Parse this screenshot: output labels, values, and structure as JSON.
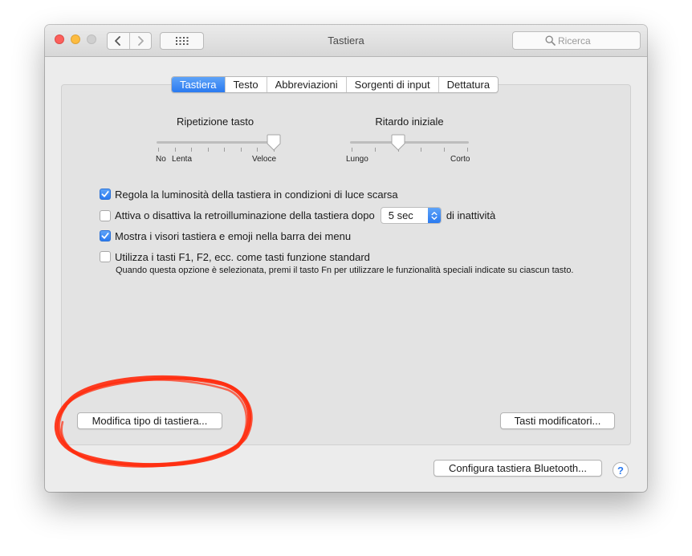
{
  "window": {
    "title": "Tastiera"
  },
  "toolbar": {
    "search_placeholder": "Ricerca"
  },
  "tabs": [
    {
      "label": "Tastiera",
      "active": true
    },
    {
      "label": "Testo",
      "active": false
    },
    {
      "label": "Abbreviazioni",
      "active": false
    },
    {
      "label": "Sorgenti di input",
      "active": false
    },
    {
      "label": "Dettatura",
      "active": false
    }
  ],
  "sliders": {
    "key_repeat": {
      "title": "Ripetizione tasto",
      "labels": [
        "No",
        "Lenta",
        "Veloce"
      ],
      "steps": 8,
      "value_step": 7
    },
    "initial_delay": {
      "title": "Ritardo iniziale",
      "labels": [
        "Lungo",
        "Corto"
      ],
      "steps": 6,
      "value_step": 2
    }
  },
  "options": [
    {
      "label": "Regola la luminosità della tastiera in condizioni di luce scarsa",
      "checked": true
    },
    {
      "label": "Attiva o disattiva la retroilluminazione della tastiera dopo",
      "checked": false,
      "select_value": "5 sec",
      "suffix": "di inattività"
    },
    {
      "label": "Mostra i visori tastiera e emoji nella barra dei menu",
      "checked": true
    },
    {
      "label": "Utilizza i tasti F1, F2, ecc. come tasti funzione standard",
      "checked": false,
      "note": "Quando questa opzione è selezionata, premi il tasto Fn per utilizzare le funzionalità speciali indicate su ciascun tasto."
    }
  ],
  "buttons": {
    "change_keyboard_type": "Modifica tipo di tastiera...",
    "modifier_keys": "Tasti modificatori...",
    "bluetooth_keyboard": "Configura tastiera Bluetooth...",
    "help": "?"
  },
  "colors": {
    "accent": "#2a7af0",
    "annotation": "#ff2d0f",
    "panel": "#e3e3e3",
    "window": "#ececec"
  }
}
